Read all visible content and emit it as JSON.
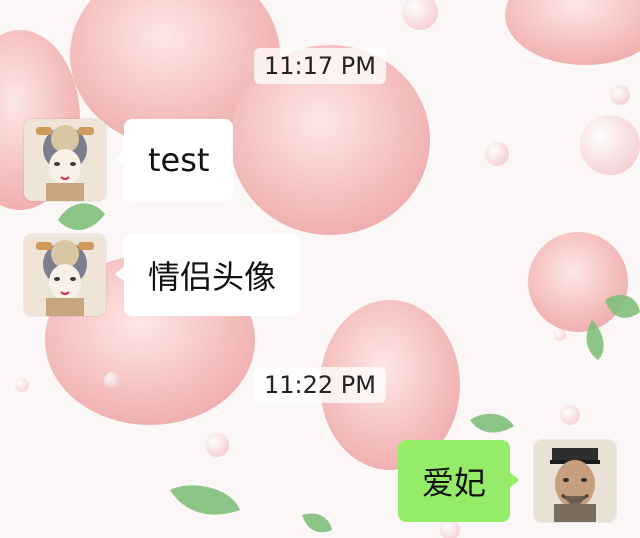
{
  "chat": {
    "time_1": "11:17 PM",
    "time_2": "11:22 PM",
    "messages": [
      {
        "side": "incoming",
        "text": "test",
        "avatar": "empress-portrait-avatar"
      },
      {
        "side": "incoming",
        "text": "情侣头像",
        "avatar": "empress-portrait-avatar"
      },
      {
        "side": "outgoing",
        "text": "爱妃",
        "avatar": "emperor-portrait-avatar"
      }
    ]
  },
  "colors": {
    "incoming_bubble": "#ffffff",
    "outgoing_bubble": "#95ec69",
    "wallpaper_peach": "#f2b0b1",
    "wallpaper_leaf": "#7fbf7a"
  }
}
